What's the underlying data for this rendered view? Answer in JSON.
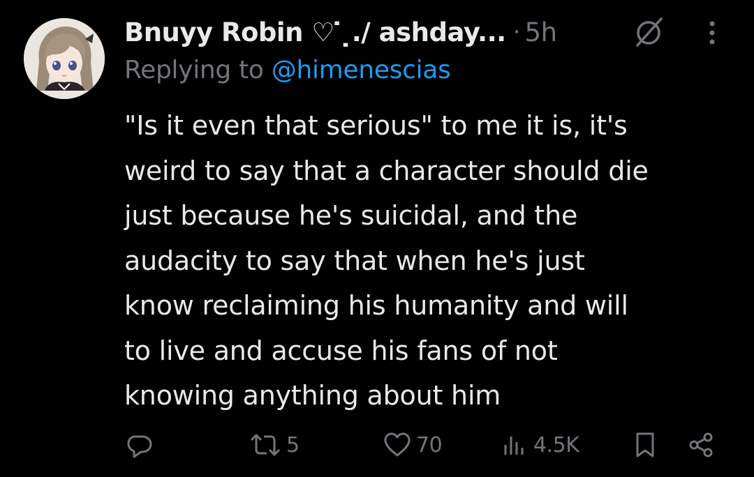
{
  "tweet": {
    "author": {
      "display_name": "Bnuyy Robin ♡ ̇ ̣./ ashday...",
      "avatar_icon": "anime-character-avatar"
    },
    "separator": "·",
    "timestamp": "5h",
    "reply": {
      "prefix": "Replying to ",
      "handle": "@himenescias"
    },
    "text": "\"Is it even that serious\" to me it is, it's\nweird to say that a character should die\njust because he's suicidal, and the\naudacity to say that when he's just\nknow reclaiming his humanity and will\nto live and accuse his fans of not\nknowing anything about him",
    "actions": {
      "reply_icon": "reply-icon",
      "retweet_icon": "retweet-icon",
      "retweet_count": "5",
      "like_icon": "heart-icon",
      "like_count": "70",
      "views_icon": "views-icon",
      "views_count": "4.5K",
      "bookmark_icon": "bookmark-icon",
      "share_icon": "share-icon"
    }
  },
  "colors": {
    "background": "#000000",
    "text_primary": "#e7e9ea",
    "text_secondary": "#71767b",
    "link": "#1d9bf0"
  }
}
